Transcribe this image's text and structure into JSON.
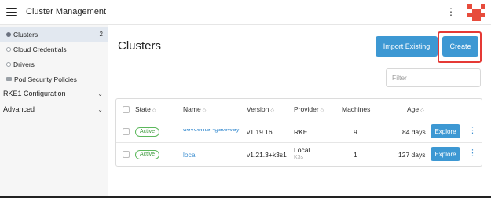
{
  "header": {
    "title": "Cluster Management",
    "menu_icon": "hamburger-icon",
    "more_icon": "vertical-ellipsis-icon",
    "kebab_glyph": "⋮",
    "avatar_colors": [
      "#e74c3c",
      "#ffffff"
    ]
  },
  "sidebar": {
    "items": [
      {
        "label": "Clusters",
        "count": "2",
        "icon": "circle-filled-icon",
        "active": true
      },
      {
        "label": "Cloud Credentials",
        "icon": "circle-outline-icon"
      },
      {
        "label": "Drivers",
        "icon": "circle-outline-icon"
      },
      {
        "label": "Pod Security Policies",
        "icon": "folder-icon"
      }
    ],
    "groups": [
      {
        "label": "RKE1 Configuration",
        "chevron": "⌄"
      },
      {
        "label": "Advanced",
        "chevron": "⌄"
      }
    ]
  },
  "main": {
    "title": "Clusters",
    "import_label": "Import Existing",
    "create_label": "Create",
    "filter_placeholder": "Filter",
    "highlight_color": "#e53935",
    "accent_color": "#3d98d3"
  },
  "table": {
    "sort_glyph": "◇",
    "columns": [
      "State",
      "Name",
      "Version",
      "Provider",
      "Machines",
      "Age"
    ],
    "rows": [
      {
        "state": "Active",
        "name": "devcenter-gateway",
        "version": "v1.19.16",
        "provider": "RKE",
        "provider_sub": "",
        "machines": "9",
        "age": "84 days",
        "action": "Explore"
      },
      {
        "state": "Active",
        "name": "local",
        "version": "v1.21.3+k3s1",
        "provider": "Local",
        "provider_sub": "K3s",
        "machines": "1",
        "age": "127 days",
        "action": "Explore"
      }
    ]
  }
}
